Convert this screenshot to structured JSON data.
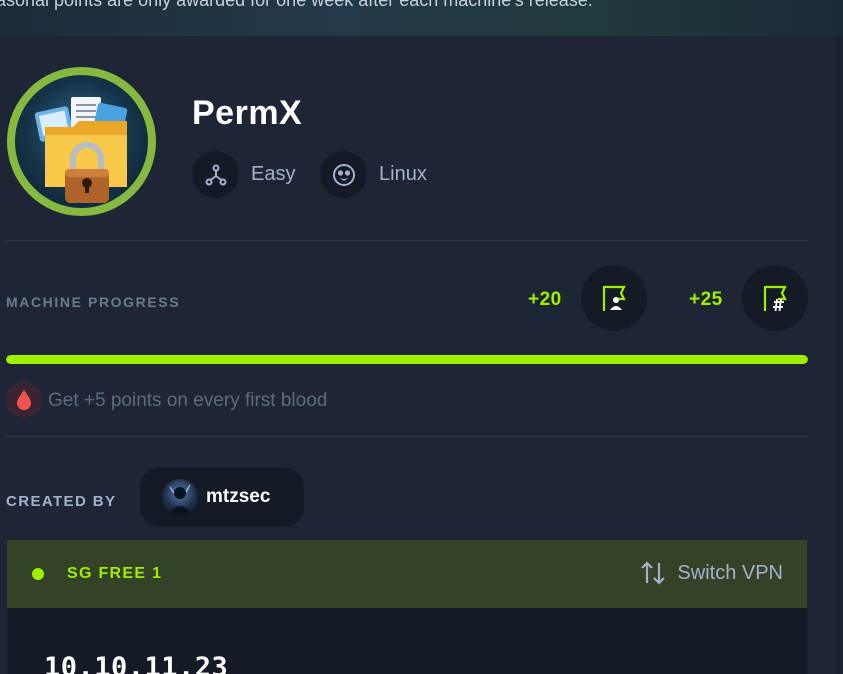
{
  "banner": {
    "text": "asonal points are only awarded for one week after each machine's release."
  },
  "machine": {
    "name": "PermX",
    "avatar_icon": "locked-folder-icon",
    "difficulty": {
      "label": "Easy",
      "icon": "difficulty-nodes-icon"
    },
    "os": {
      "label": "Linux",
      "icon": "linux-tux-icon"
    }
  },
  "progress": {
    "label": "MACHINE PROGRESS",
    "user_flag": {
      "points": "+20",
      "icon": "user-flag-icon"
    },
    "root_flag": {
      "points": "+25",
      "icon": "root-flag-icon"
    },
    "percent": 100,
    "bar_color": "#9fef00"
  },
  "first_blood": {
    "text": "Get +5 points on every first blood",
    "icon": "blood-drop-icon"
  },
  "creator": {
    "label": "CREATED BY",
    "name": "mtzsec"
  },
  "vpn": {
    "server": "SG FREE 1",
    "switch_label": "Switch VPN",
    "switch_icon": "swap-vertical-icon",
    "ip": "10.10.11.23"
  },
  "colors": {
    "accent": "#9fef00",
    "background": "#1e2636",
    "vpn_header": "#344227",
    "ring": "#86b940"
  }
}
